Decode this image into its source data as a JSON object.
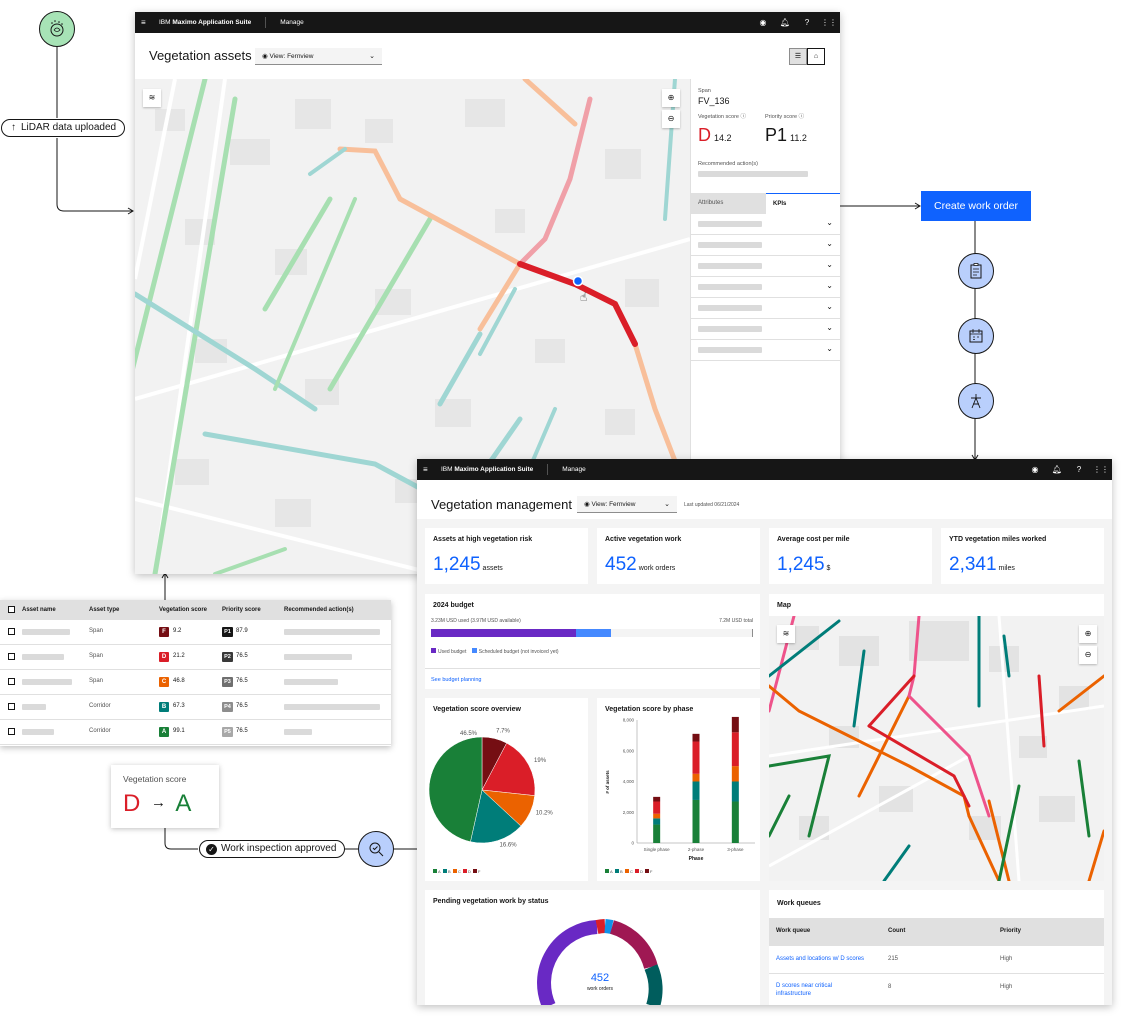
{
  "flow": {
    "lidar_label": "LiDAR data uploaded",
    "create_work_order": "Create work order",
    "inspection_label": "Work inspection approved"
  },
  "score_card": {
    "title": "Vegetation score",
    "from": "D",
    "arrow": "→",
    "to": "A"
  },
  "top_window": {
    "hamburger": "≡",
    "brand_prefix": "IBM ",
    "brand_name": "Maximo Application Suite",
    "nav": "Manage",
    "title": "Vegetation assets",
    "view_select": "View: Fernview",
    "panel": {
      "span_label": "Span",
      "span_id": "FV_136",
      "veg_score_label": "Vegetation score ⓘ",
      "priority_score_label": "Priority score ⓘ",
      "veg_grade": "D",
      "veg_value": "14.2",
      "priority_grade": "P1",
      "priority_value": "11.2",
      "recommended_label": "Recommended action(s)",
      "tab_attributes": "Attributes",
      "tab_kpis": "KPIs"
    }
  },
  "asset_table": {
    "headers": [
      "Asset name",
      "Asset type",
      "Vegetation score",
      "Priority score",
      "Recommended action(s)"
    ],
    "rows": [
      {
        "type": "Span",
        "grade": "F",
        "grade_color": "#750e13",
        "score": "9.2",
        "priority": "P1",
        "priority_color": "#161616",
        "score2": "87.9"
      },
      {
        "type": "Span",
        "grade": "D",
        "grade_color": "#da1e28",
        "score": "21.2",
        "priority": "P2",
        "priority_color": "#393939",
        "score2": "76.5"
      },
      {
        "type": "Span",
        "grade": "C",
        "grade_color": "#eb6200",
        "score": "46.8",
        "priority": "P3",
        "priority_color": "#6f6f6f",
        "score2": "76.5"
      },
      {
        "type": "Corridor",
        "grade": "B",
        "grade_color": "#007d79",
        "score": "67.3",
        "priority": "P4",
        "priority_color": "#8d8d8d",
        "score2": "76.5"
      },
      {
        "type": "Corridor",
        "grade": "A",
        "grade_color": "#198038",
        "score": "99.1",
        "priority": "P5",
        "priority_color": "#a8a8a8",
        "score2": "76.5"
      }
    ]
  },
  "dashboard": {
    "brand_prefix": "IBM ",
    "brand_name": "Maximo Application Suite",
    "nav": "Manage",
    "title": "Vegetation management",
    "view_select": "View: Fernview",
    "last_updated": "Last updated 06/21/2024",
    "kpis": [
      {
        "title": "Assets at high vegetation risk",
        "value": "1,245",
        "unit": "assets"
      },
      {
        "title": "Active vegetation work",
        "value": "452",
        "unit": "work orders"
      },
      {
        "title": "Average cost per mile",
        "value": "1,245",
        "unit": "$"
      },
      {
        "title": "YTD vegetation miles worked",
        "value": "2,341",
        "unit": "miles"
      }
    ],
    "budget": {
      "title": "2024 budget",
      "used_text": "3.23M USD used (3.97M USD available)",
      "total_text": "7.2M USD total",
      "used_fraction": 0.45,
      "scheduled_fraction": 0.11,
      "legend_used": "Used budget",
      "legend_scheduled": "Scheduled budget (not invoiced yet)",
      "link": "See budget planning"
    },
    "map_title": "Map",
    "pending_title": "Pending vegetation work by status",
    "donut_value": "452",
    "donut_unit": "work orders",
    "work_queues": {
      "title": "Work queues",
      "headers": [
        "Work queue",
        "Count",
        "Priority"
      ],
      "rows": [
        {
          "queue": "Assets and locations w/ D scores",
          "count": "215",
          "priority": "High"
        },
        {
          "queue_line1": "D scores near critical",
          "queue_line2": "infrastructure",
          "count": "8",
          "priority": "High"
        }
      ]
    }
  },
  "chart_data": [
    {
      "type": "pie",
      "title": "Vegetation score overview",
      "categories": [
        "A",
        "B",
        "C",
        "D",
        "F"
      ],
      "values": [
        46.5,
        16.6,
        10.2,
        19,
        7.7
      ],
      "value_labels": [
        "46.5%",
        "16.6%",
        "10.2%",
        "19%",
        "7.7%"
      ],
      "colors": [
        "#198038",
        "#007d79",
        "#eb6200",
        "#da1e28",
        "#750e13"
      ],
      "legend": [
        "A",
        "B",
        "C",
        "D",
        "F"
      ]
    },
    {
      "type": "bar",
      "stacked": true,
      "title": "Vegetation score by phase",
      "xlabel": "Phase",
      "ylabel": "# of assets",
      "categories": [
        "Single phase",
        "2-phase",
        "3-phase"
      ],
      "ylim": [
        0,
        8000
      ],
      "yticks": [
        "0",
        "2,000",
        "4,000",
        "6,000",
        "8,000"
      ],
      "series": [
        {
          "name": "A",
          "color": "#198038",
          "values": [
            1200,
            2800,
            2700
          ]
        },
        {
          "name": "B",
          "color": "#007d79",
          "values": [
            400,
            1200,
            1300
          ]
        },
        {
          "name": "C",
          "color": "#eb6200",
          "values": [
            300,
            500,
            1000
          ]
        },
        {
          "name": "D",
          "color": "#da1e28",
          "values": [
            800,
            2100,
            2200
          ]
        },
        {
          "name": "F",
          "color": "#750e13",
          "values": [
            300,
            500,
            1000
          ]
        }
      ],
      "legend": [
        "A",
        "B",
        "C",
        "D",
        "F"
      ]
    }
  ]
}
